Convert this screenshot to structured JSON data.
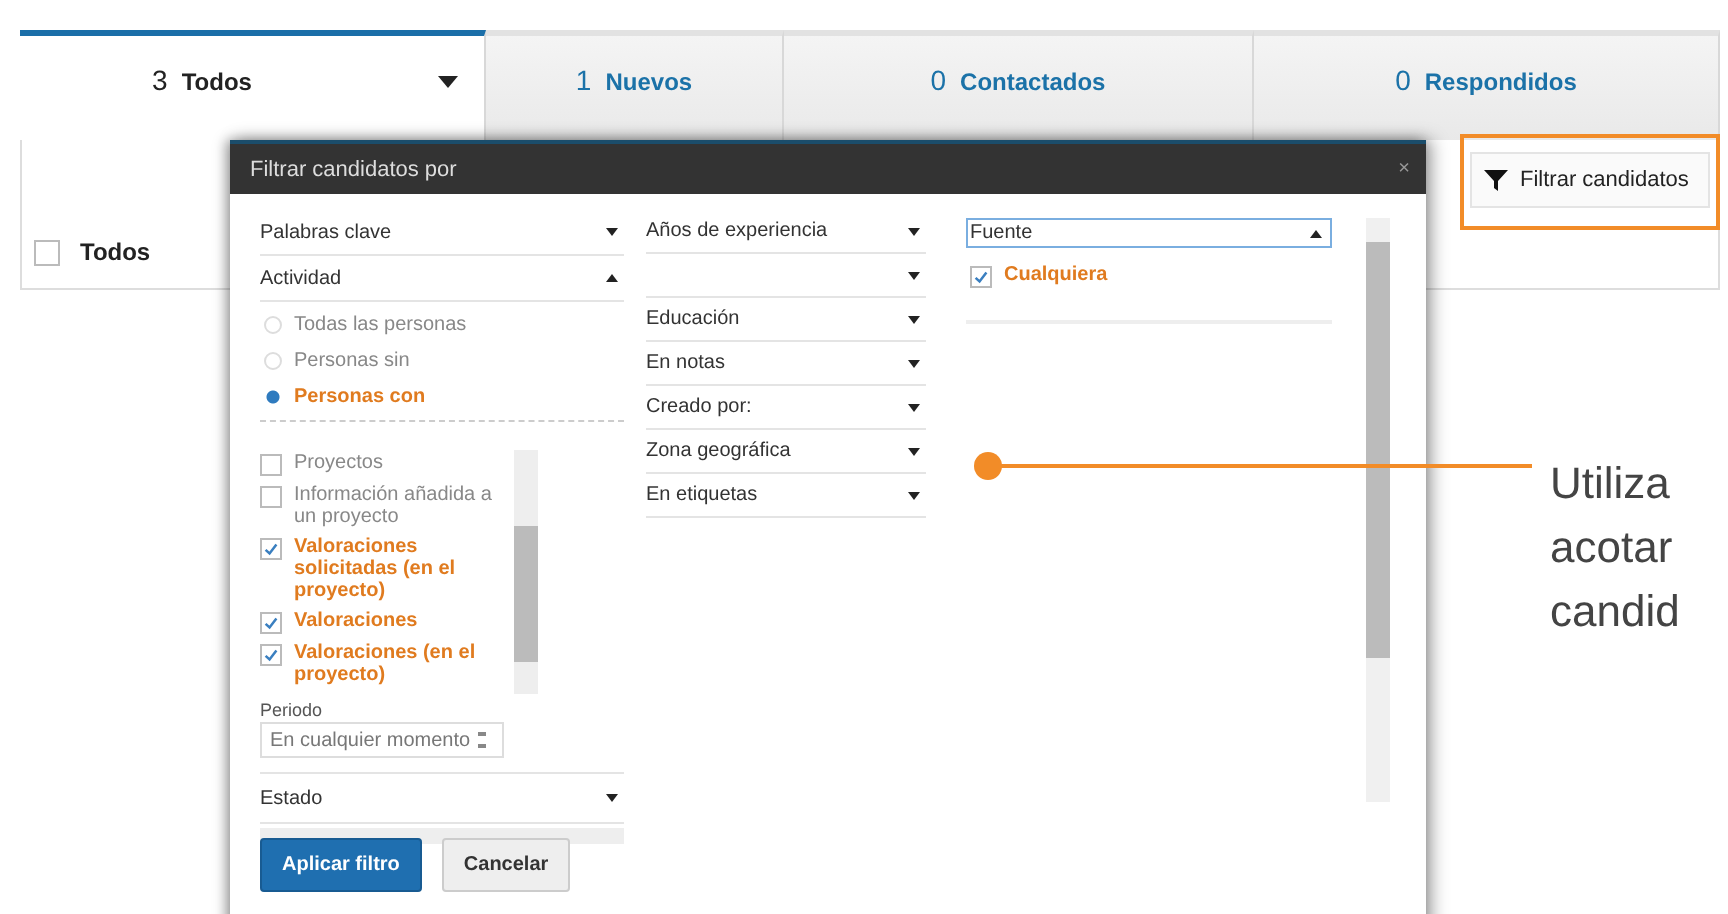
{
  "tabs": [
    {
      "count": "3",
      "label": "Todos",
      "selected": true,
      "has_dropdown": true
    },
    {
      "count": "1",
      "label": "Nuevos",
      "selected": false,
      "has_dropdown": false
    },
    {
      "count": "0",
      "label": "Contactados",
      "selected": false,
      "has_dropdown": false
    },
    {
      "count": "0",
      "label": "Respondidos",
      "selected": false,
      "has_dropdown": false
    }
  ],
  "select_all": {
    "label": "Todos",
    "checked": false
  },
  "filter_button": {
    "label": "Filtrar candidatos",
    "highlighted": true
  },
  "dialog": {
    "title": "Filtrar candidatos por",
    "close": "×",
    "column_1": {
      "sections": [
        {
          "label": "Palabras clave",
          "expanded": false
        },
        {
          "label": "Actividad",
          "expanded": true
        }
      ],
      "activity_options": [
        {
          "label": "Todas las personas",
          "selected": false
        },
        {
          "label": "Personas sin",
          "selected": false
        },
        {
          "label": "Personas con",
          "selected": true
        }
      ],
      "activities": [
        {
          "label": "Proyectos",
          "checked": false
        },
        {
          "label": "Información añadida a un proyecto",
          "checked": false
        },
        {
          "label": "Valoraciones solicitadas (en el proyecto)",
          "checked": true
        },
        {
          "label": "Valoraciones",
          "checked": true
        },
        {
          "label": "Valoraciones (en el proyecto)",
          "checked": true
        }
      ],
      "period": {
        "label": "Periodo",
        "value": "En cualquier momento"
      },
      "status": {
        "label": "Estado",
        "expanded": false
      }
    },
    "column_2": [
      {
        "label": "Años de experiencia",
        "expanded": false
      },
      {
        "expanded": false
      },
      {
        "label": "Educación",
        "expanded": false
      },
      {
        "label": "En notas",
        "expanded": false
      },
      {
        "label": "Creado por:",
        "expanded": false
      },
      {
        "label": "Zona geográfica",
        "expanded": false
      },
      {
        "label": "En etiquetas",
        "expanded": false
      }
    ],
    "column_3": {
      "select": {
        "label": "Fuente",
        "expanded": true
      },
      "options": [
        {
          "label": "Cualquiera",
          "checked": true
        }
      ]
    },
    "buttons": [
      {
        "label": "Aplicar filtro",
        "kind": "primary"
      },
      {
        "label": "Cancelar",
        "kind": "secondary"
      }
    ]
  },
  "callout": {
    "lines": [
      "Utiliza",
      "acotar",
      "candid"
    ]
  }
}
